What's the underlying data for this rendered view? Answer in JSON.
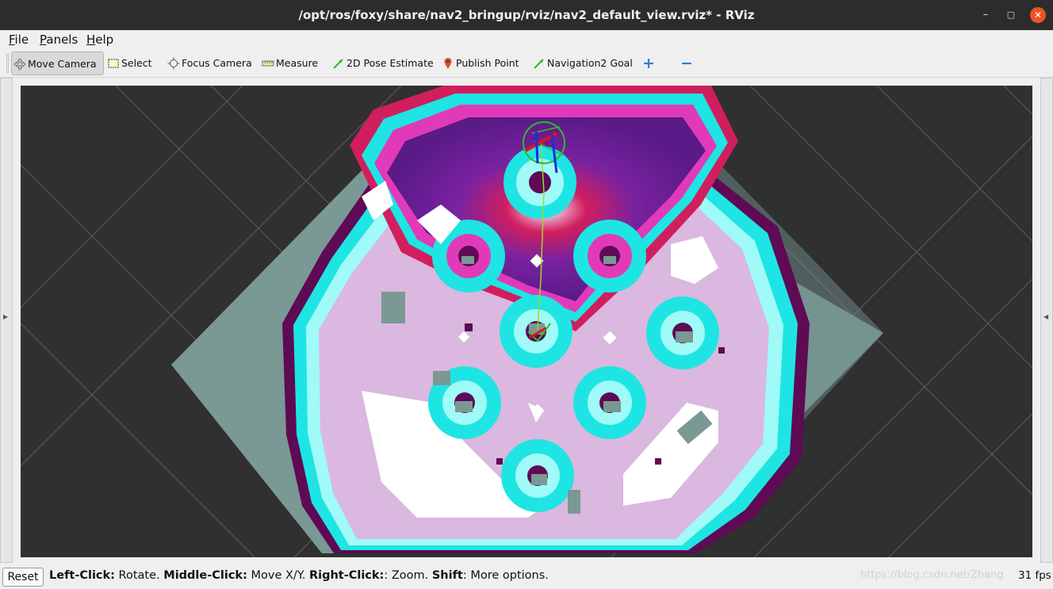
{
  "window": {
    "title": "/opt/ros/foxy/share/nav2_bringup/rviz/nav2_default_view.rviz* - RViz",
    "minimize_glyph": "–",
    "maximize_glyph": "▢",
    "close_glyph": "✕"
  },
  "menubar": {
    "items": [
      {
        "key": "F",
        "rest": "ile"
      },
      {
        "key": "P",
        "rest": "anels"
      },
      {
        "key": "H",
        "rest": "elp"
      }
    ]
  },
  "toolbar": {
    "tools": [
      {
        "label": "Move Camera",
        "icon": "move-camera-icon",
        "active": true
      },
      {
        "label": "Select",
        "icon": "select-icon"
      },
      {
        "label": "Focus Camera",
        "icon": "focus-camera-icon"
      },
      {
        "label": "Measure",
        "icon": "measure-icon"
      },
      {
        "label": "2D Pose Estimate",
        "icon": "pose-estimate-icon",
        "color": "#2bbf24"
      },
      {
        "label": "Publish Point",
        "icon": "publish-point-icon",
        "color": "#d9542a"
      },
      {
        "label": "Navigation2 Goal",
        "icon": "nav-goal-icon",
        "color": "#2bbf24"
      }
    ],
    "add_icon": "plus-icon",
    "remove_icon": "minus-icon"
  },
  "viewport": {
    "background": "#303030",
    "colors": {
      "unknown_area": "#7a9894",
      "free_cell": "#ffffff",
      "inflation_light": "#dab8df",
      "inflation_pink": "#f0a2c6",
      "inscribed": "#9ffaf8",
      "cyan": "#1ee5e3",
      "lethal": "#5e0a55",
      "global_magenta": "#e13ab8",
      "global_purple": "#7a22a0",
      "global_red": "#d11e5e",
      "path": "#9ad92f"
    }
  },
  "statusbar": {
    "reset_label": "Reset",
    "help_parts": [
      {
        "b": "Left-Click:",
        "t": " Rotate. "
      },
      {
        "b": "Middle-Click:",
        "t": " Move X/Y. "
      },
      {
        "b": "Right-Click:",
        "t": ": Zoom. "
      },
      {
        "b": "Shift",
        "t": ": More options."
      }
    ],
    "watermark": "https://blog.csdn.net/Zhang",
    "fps": "31 fps"
  }
}
